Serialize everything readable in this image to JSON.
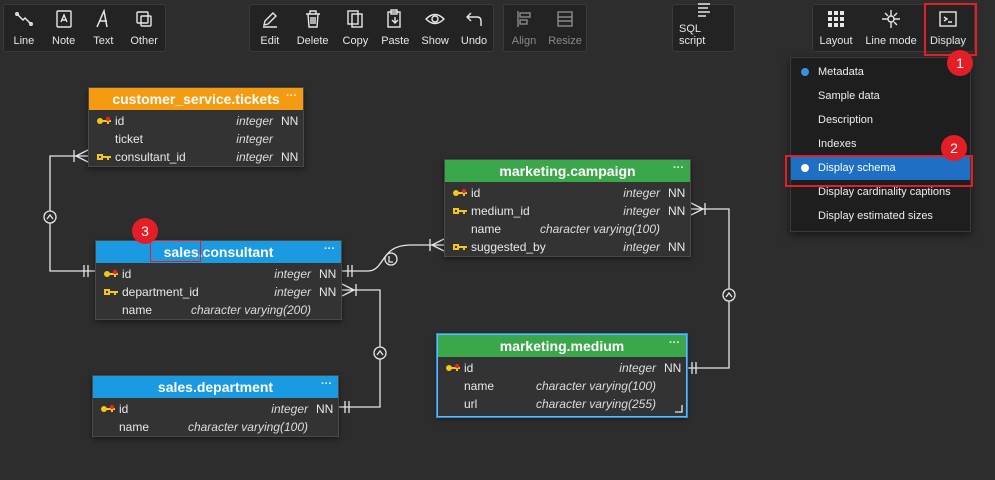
{
  "toolbar": {
    "groups": [
      {
        "items": [
          {
            "label": "Line",
            "icon": "line-icon"
          },
          {
            "label": "Note",
            "icon": "note-icon"
          },
          {
            "label": "Text",
            "icon": "text-icon"
          },
          {
            "label": "Other",
            "icon": "other-icon"
          }
        ]
      },
      {
        "items": [
          {
            "label": "Edit",
            "icon": "edit-icon"
          },
          {
            "label": "Delete",
            "icon": "delete-icon"
          },
          {
            "label": "Copy",
            "icon": "copy-icon"
          },
          {
            "label": "Paste",
            "icon": "paste-icon"
          },
          {
            "label": "Show",
            "icon": "show-icon"
          },
          {
            "label": "Undo",
            "icon": "undo-icon"
          }
        ]
      },
      {
        "items": [
          {
            "label": "Align",
            "icon": "align-icon"
          },
          {
            "label": "Resize",
            "icon": "resize-icon"
          }
        ]
      },
      {
        "items": [
          {
            "label": "SQL script",
            "icon": "sql-script-icon"
          }
        ]
      },
      {
        "items": [
          {
            "label": "Layout",
            "icon": "layout-icon"
          },
          {
            "label": "Line mode",
            "icon": "line-mode-icon"
          },
          {
            "label": "Display",
            "icon": "display-icon"
          }
        ]
      }
    ]
  },
  "tables": {
    "tickets": {
      "title": "customer_service.tickets",
      "color": "#f59b12",
      "columns": [
        {
          "name": "id",
          "type": "integer",
          "nn": "NN",
          "key": "pk-fk"
        },
        {
          "name": "ticket",
          "type": "integer",
          "nn": "",
          "key": ""
        },
        {
          "name": "consultant_id",
          "type": "integer",
          "nn": "NN",
          "key": "fk"
        }
      ]
    },
    "consultant": {
      "title_part1": "sales",
      "title_part2": "consultant",
      "color": "#1a9ae0",
      "columns": [
        {
          "name": "id",
          "type": "integer",
          "nn": "NN",
          "key": "pk-fk"
        },
        {
          "name": "department_id",
          "type": "integer",
          "nn": "NN",
          "key": "fk"
        },
        {
          "name": "name",
          "type": "character varying(200)",
          "nn": "",
          "key": ""
        }
      ]
    },
    "department": {
      "title": "sales.department",
      "color": "#1a9ae0",
      "columns": [
        {
          "name": "id",
          "type": "integer",
          "nn": "NN",
          "key": "pk-fk"
        },
        {
          "name": "name",
          "type": "character varying(100)",
          "nn": "",
          "key": ""
        }
      ]
    },
    "campaign": {
      "title": "marketing.campaign",
      "color": "#3aa84a",
      "columns": [
        {
          "name": "id",
          "type": "integer",
          "nn": "NN",
          "key": "pk-fk"
        },
        {
          "name": "medium_id",
          "type": "integer",
          "nn": "NN",
          "key": "fk"
        },
        {
          "name": "name",
          "type": "character varying(100)",
          "nn": "",
          "key": ""
        },
        {
          "name": "suggested_by",
          "type": "integer",
          "nn": "NN",
          "key": "fk"
        }
      ]
    },
    "medium": {
      "title": "marketing.medium",
      "color": "#3aa84a",
      "columns": [
        {
          "name": "id",
          "type": "integer",
          "nn": "NN",
          "key": "pk-fk"
        },
        {
          "name": "name",
          "type": "character varying(100)",
          "nn": "",
          "key": ""
        },
        {
          "name": "url",
          "type": "character varying(255)",
          "nn": "",
          "key": ""
        }
      ]
    }
  },
  "table_menu_glyph": "···",
  "display_menu": {
    "items": [
      {
        "label": "Metadata",
        "checked": true,
        "selected": false
      },
      {
        "label": "Sample data",
        "checked": false,
        "selected": false
      },
      {
        "label": "Description",
        "checked": false,
        "selected": false
      },
      {
        "label": "Indexes",
        "checked": false,
        "selected": false
      },
      {
        "label": "Display schema",
        "checked": true,
        "selected": true
      },
      {
        "label": "Display cardinality captions",
        "checked": false,
        "selected": false
      },
      {
        "label": "Display estimated sizes",
        "checked": false,
        "selected": false
      }
    ]
  },
  "badges": [
    "1",
    "2",
    "3"
  ],
  "colors": {
    "highlight": "#e41e26",
    "selection": "#1f6fc4",
    "canvas": "#2d2d2d"
  }
}
